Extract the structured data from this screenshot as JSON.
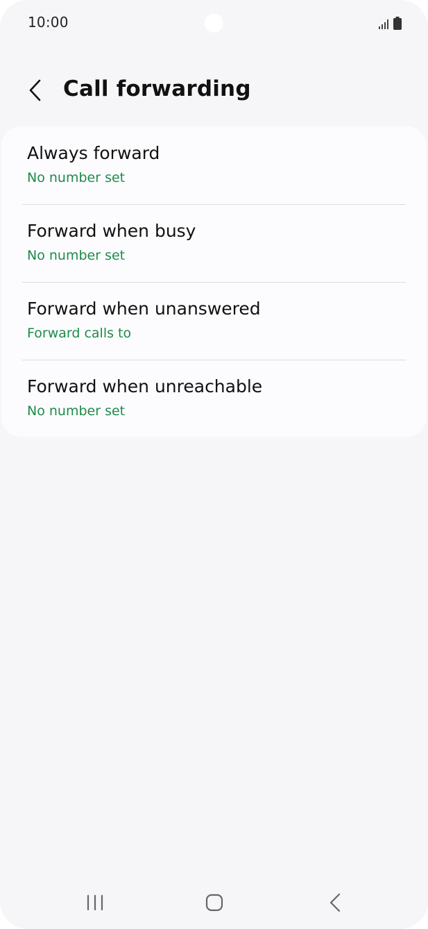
{
  "status_bar": {
    "time": "10:00",
    "icons": [
      "signal-icon",
      "battery-icon"
    ]
  },
  "header": {
    "back_icon": "chevron-left-icon",
    "title": "Call forwarding"
  },
  "options": [
    {
      "title": "Always forward",
      "subtitle": "No number set"
    },
    {
      "title": "Forward when busy",
      "subtitle": "No number set"
    },
    {
      "title": "Forward when unanswered",
      "subtitle": "Forward calls to"
    },
    {
      "title": "Forward when unreachable",
      "subtitle": "No number set"
    }
  ],
  "navigation": {
    "recents_icon": "recent-apps-icon",
    "home_icon": "home-icon",
    "back_icon": "back-icon"
  },
  "colors": {
    "background": "#f6f6f8",
    "card": "#fcfcfe",
    "accent_green": "#1e8a4a"
  }
}
